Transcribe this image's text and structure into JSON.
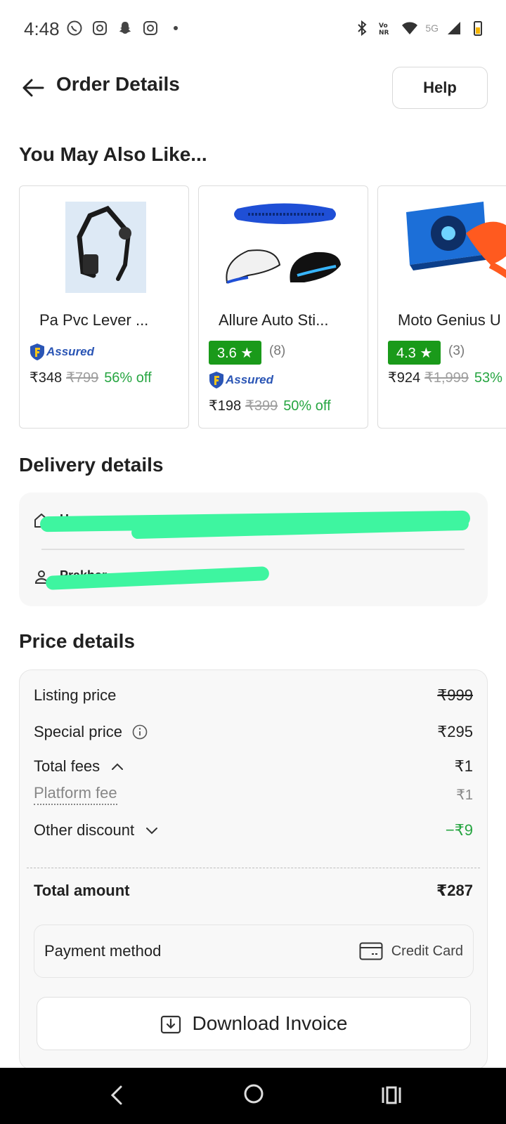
{
  "status_bar": {
    "time": "4:48",
    "network": "5G",
    "left_icons": [
      "whatsapp-icon",
      "instagram-icon",
      "snapchat-icon",
      "instagram-icon",
      "dot-icon"
    ],
    "right_icons": [
      "bluetooth-icon",
      "volte-nr-icon",
      "wifi-icon",
      "signal-icon",
      "battery-icon"
    ]
  },
  "header": {
    "title": "Order Details",
    "help_label": "Help"
  },
  "recommendations": {
    "title": "You May Also Like...",
    "assured_label": "Assured",
    "items": [
      {
        "name": "Pa Pvc Lever ...",
        "rating": "",
        "rating_count": "",
        "assured": true,
        "price": "₹348",
        "mrp": "₹799",
        "discount": "56% off"
      },
      {
        "name": "Allure Auto Sti...",
        "rating": "3.6 ★",
        "rating_count": "(8)",
        "assured": true,
        "price": "₹198",
        "mrp": "₹399",
        "discount": "50% off"
      },
      {
        "name": "Moto Genius U",
        "rating": "4.3 ★",
        "rating_count": "(3)",
        "assured": false,
        "price": "₹924",
        "mrp": "₹1,999",
        "discount": "53%"
      }
    ]
  },
  "delivery": {
    "title": "Delivery details",
    "address_label": "Home",
    "name_partial": "Prakhar"
  },
  "price_details": {
    "title": "Price details",
    "listing_label": "Listing price",
    "listing_value": "₹999",
    "special_label": "Special price",
    "special_value": "₹295",
    "fees_label": "Total fees",
    "fees_value": "₹1",
    "platform_label": "Platform fee",
    "platform_value": "₹1",
    "discount_label": "Other discount",
    "discount_value": "−₹9",
    "total_label": "Total amount",
    "total_value": "₹287",
    "payment_label": "Payment method",
    "payment_value": "Credit Card",
    "invoice_label": "Download Invoice"
  },
  "colors": {
    "rating_green": "#1a9a1a",
    "discount_green": "#26a541",
    "assured_blue": "#2a55b5",
    "redaction": "#3ef5a0"
  }
}
